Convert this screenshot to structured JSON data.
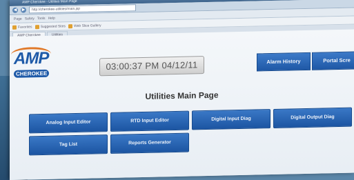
{
  "browser": {
    "window_title": "AMP Cherokee - Utilities Main Page",
    "url": "http://cherokee-utilities/main.jsp",
    "tabs": [
      {
        "label": "AMP Cherokee"
      },
      {
        "label": "Utilities"
      }
    ],
    "menu": [
      "Page",
      "Safety",
      "Tools",
      "Help"
    ],
    "favorites": [
      {
        "label": "Favorites"
      },
      {
        "label": "Suggested Sites"
      },
      {
        "label": "Web Slice Gallery"
      }
    ]
  },
  "logo": {
    "main": "AMP",
    "sub": "CHEROKEE"
  },
  "clock": {
    "value": "03:00:37 PM 04/12/11"
  },
  "header_buttons": {
    "alarm_history": "Alarm History",
    "portal_screen": "Portal Scre"
  },
  "page": {
    "title": "Utilities Main Page"
  },
  "buttons": {
    "analog_input_editor": "Analog Input Editor",
    "rtd_input_editor": "RTD Input Editor",
    "digital_input_diag": "Digital Input Diag",
    "digital_output_diag": "Digital Output Diag",
    "tag_list": "Tag List",
    "reports_generator": "Reports Generator"
  },
  "colors": {
    "button_blue": "#1f58a6",
    "logo_blue": "#1e5aa8",
    "logo_orange": "#e07828"
  }
}
